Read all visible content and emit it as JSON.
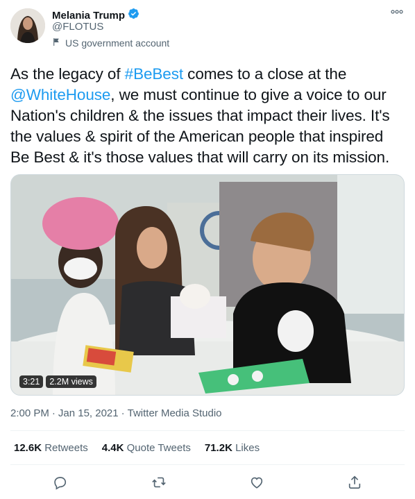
{
  "user": {
    "name": "Melania Trump",
    "handle": "@FLOTUS",
    "label": "US government account",
    "verified": true
  },
  "tweet": {
    "segments": [
      {
        "text": "As the legacy of ",
        "link": false
      },
      {
        "text": "#BeBest",
        "link": true
      },
      {
        "text": " comes to a close at the ",
        "link": false
      },
      {
        "text": "@WhiteHouse",
        "link": true
      },
      {
        "text": ", we must continue to give a voice to our Nation's children & the issues that impact their lives. It's the values & spirit of the American people that inspired Be Best & it's those values that will carry on its mission.",
        "link": false
      }
    ]
  },
  "media": {
    "duration": "3:21",
    "views": "2.2M views"
  },
  "meta": {
    "time": "2:00 PM",
    "date": "Jan 15, 2021",
    "source": "Twitter Media Studio"
  },
  "stats": {
    "retweets_count": "12.6K",
    "retweets_label": "Retweets",
    "quotes_count": "4.4K",
    "quotes_label": "Quote Tweets",
    "likes_count": "71.2K",
    "likes_label": "Likes"
  },
  "colors": {
    "link": "#1d9bf0",
    "secondary_text": "#536471",
    "verified_badge": "#1d9bf0"
  },
  "icons": {
    "more": "more-icon",
    "verified": "verified-badge-icon",
    "government": "government-flag-icon",
    "reply": "reply-icon",
    "retweet": "retweet-icon",
    "like": "like-icon",
    "share": "share-icon"
  }
}
